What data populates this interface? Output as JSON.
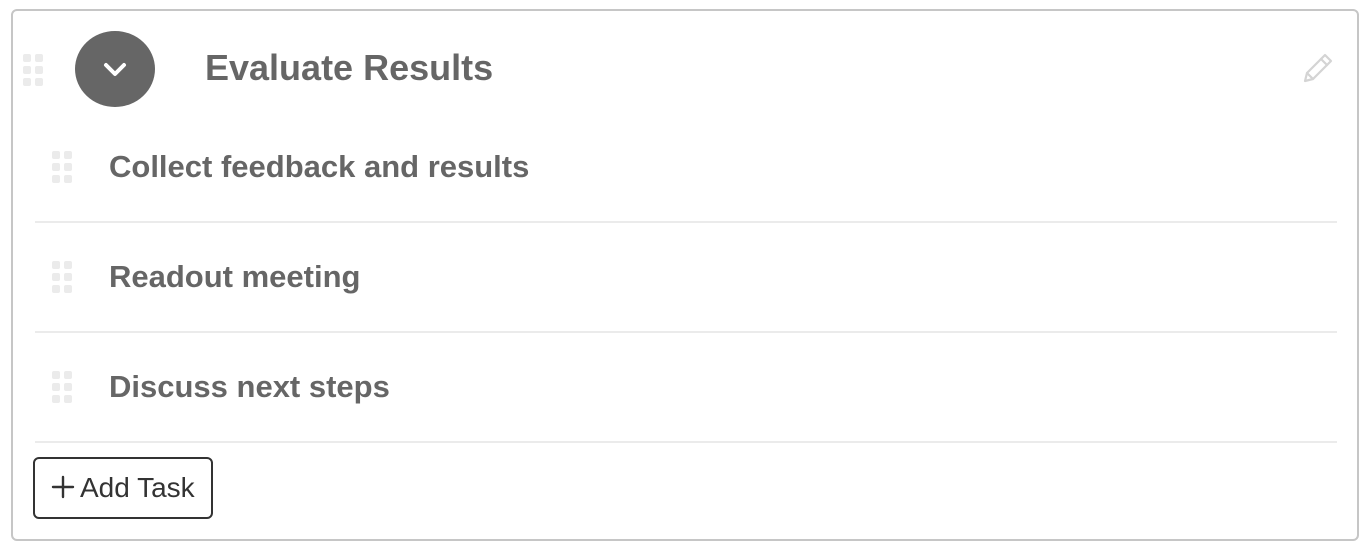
{
  "section": {
    "title": "Evaluate Results",
    "icons": {
      "drag_handle": "drag-handle-icon",
      "collapse": "chevron-down-icon",
      "edit": "pencil-icon"
    }
  },
  "tasks": [
    {
      "name": "Collect feedback and results"
    },
    {
      "name": "Readout meeting"
    },
    {
      "name": "Discuss next steps"
    }
  ],
  "actions": {
    "add_task_label": "Add Task",
    "add_task_icon": "plus-icon"
  },
  "colors": {
    "title_text": "#666666",
    "collapse_button_bg": "#666666",
    "card_border": "#c6c6c6",
    "row_divider": "#ebebeb",
    "drag_handle": "#ebebeb",
    "edit_icon": "#d4d4d4",
    "add_task_border": "#333333"
  }
}
